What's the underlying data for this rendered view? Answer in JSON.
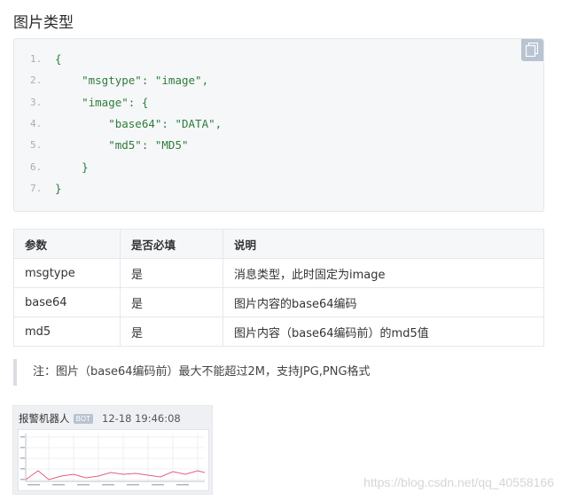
{
  "section_title": "图片类型",
  "code": {
    "copy_icon": "copy-icon",
    "line_numbers": [
      "1.",
      "2.",
      "3.",
      "4.",
      "5.",
      "6.",
      "7."
    ],
    "lines": [
      "{",
      "    \"msgtype\": \"image\",",
      "    \"image\": {",
      "        \"base64\": \"DATA\",",
      "        \"md5\": \"MD5\"",
      "    }",
      "}"
    ]
  },
  "table": {
    "headers": [
      "参数",
      "是否必填",
      "说明"
    ],
    "rows": [
      [
        "msgtype",
        "是",
        "消息类型，此时固定为image"
      ],
      [
        "base64",
        "是",
        "图片内容的base64编码"
      ],
      [
        "md5",
        "是",
        "图片内容（base64编码前）的md5值"
      ]
    ]
  },
  "note": "注：图片（base64编码前）最大不能超过2M，支持JPG,PNG格式",
  "preview": {
    "sender": "报警机器人",
    "badge": "BOT",
    "time": "12-18 19:46:08"
  },
  "watermark": "https://blog.csdn.net/qq_40558166",
  "colors": {
    "accent": "#2f7d3a",
    "chart_line": "#e0627a"
  }
}
